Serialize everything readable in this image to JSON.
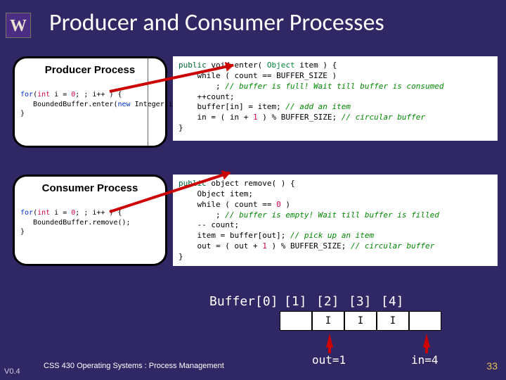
{
  "logo": "W",
  "title": "Producer and Consumer Processes",
  "producer": {
    "label": "Producer Process",
    "code": {
      "l1a": "for",
      "l1b": "(",
      "l1c": "int",
      "l1d": " i = ",
      "l1e": "0",
      "l1f": "; ; i++ ) {",
      "l2a": "   BoundedBuffer.enter(",
      "l2b": "new",
      "l2c": " Integer(i));",
      "l3a": "}"
    }
  },
  "consumer": {
    "label": "Consumer Process",
    "code": {
      "l1a": "for",
      "l1b": "(",
      "l1c": "int",
      "l1d": " i = ",
      "l1e": "0",
      "l1f": "; ; i++ ) {",
      "l2a": "   BoundedBuffer.remove();",
      "l3a": "}"
    }
  },
  "enter_code": {
    "l1a": "public",
    "l1b": " void ",
    "l1c": "enter",
    "l1d": "( ",
    "l1e": "Object",
    "l1f": " item ) {",
    "l2a": "    while ( count == BUFFER_SIZE )",
    "l3a": "        ; ",
    "l3b": "// buffer is full! Wait till buffer is consumed",
    "l4a": "    ++count;",
    "l5a": "    buffer[in] = item; ",
    "l5b": "// add an item",
    "l6a": "    in = ( in + ",
    "l6b": "1",
    "l6c": " ) % BUFFER_SIZE; ",
    "l6d": "// circular buffer",
    "l7a": "}"
  },
  "remove_code": {
    "l1a": "public",
    "l1b": " object ",
    "l1c": "remove",
    "l1d": "( ) {",
    "l2a": "    Object item;",
    "l3a": "    while ( count == ",
    "l3b": "0",
    "l3c": " )",
    "l4a": "        ; ",
    "l4b": "// buffer is empty! Wait till buffer is filled",
    "l5a": "    -- count;",
    "l6a": "    item = buffer[out]; ",
    "l6b": "// pick up an item",
    "l7a": "    out = ( out + ",
    "l7b": "1",
    "l7c": " ) % BUFFER_SIZE; ",
    "l7d": "// circular buffer",
    "l8a": "}"
  },
  "buffer": {
    "labels": [
      "Buffer[0]",
      "[1]",
      "[2]",
      "[3]",
      "[4]"
    ],
    "label_pos": [
      298,
      404,
      450,
      496,
      542
    ],
    "header_full": "Buffer[0] [1] [2] [3] [4]",
    "cells": [
      "",
      "I",
      "I",
      "I",
      ""
    ]
  },
  "pointers": {
    "out": "out=1",
    "in": "in=4"
  },
  "footer": {
    "course": "CSS 430 Operating Systems : Process Management",
    "version": "V0.4",
    "page": "33"
  }
}
